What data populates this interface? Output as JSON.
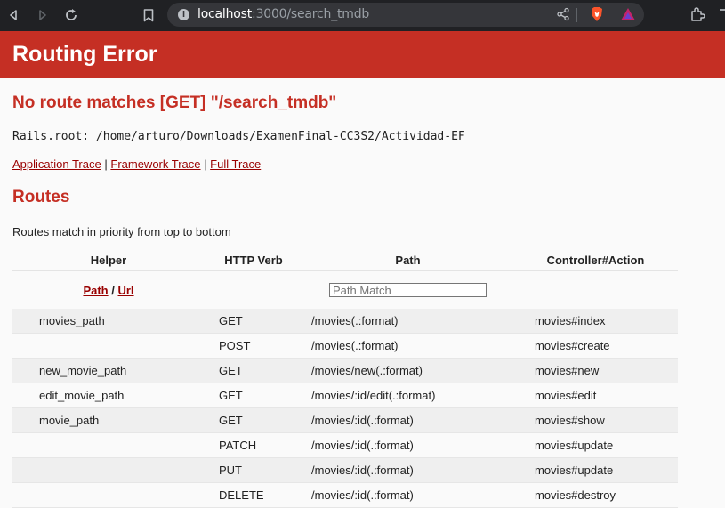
{
  "browser": {
    "url_host": "localhost",
    "url_rest": ":3000/search_tmdb",
    "icons": {
      "back": "back-arrow-icon",
      "forward": "forward-arrow-icon",
      "reload": "reload-icon",
      "bookmark": "bookmark-icon",
      "info": "site-info-icon",
      "share": "share-icon",
      "brave": "brave-shields-icon",
      "rewards": "brave-rewards-icon",
      "extensions": "extensions-icon"
    }
  },
  "page": {
    "header": "Routing Error",
    "message": "No route matches [GET] \"/search_tmdb\"",
    "rails_root_label": "Rails.root:",
    "rails_root": "/home/arturo/Downloads/ExamenFinal-CC3S2/Actividad-EF",
    "traces": {
      "application": "Application Trace",
      "framework": "Framework Trace",
      "full": "Full Trace",
      "separator": "|"
    },
    "routes_heading": "Routes",
    "routes_intro": "Routes match in priority from top to bottom"
  },
  "routes_table": {
    "headers": {
      "helper": "Helper",
      "verb": "HTTP Verb",
      "path": "Path",
      "action": "Controller#Action"
    },
    "filter": {
      "path_link": "Path",
      "separator": "/",
      "url_link": "Url",
      "search_placeholder": "Path Match"
    },
    "rows": [
      {
        "helper": "movies_path",
        "verb": "GET",
        "path": "/movies(.:format)",
        "action": "movies#index"
      },
      {
        "helper": "",
        "verb": "POST",
        "path": "/movies(.:format)",
        "action": "movies#create"
      },
      {
        "helper": "new_movie_path",
        "verb": "GET",
        "path": "/movies/new(.:format)",
        "action": "movies#new"
      },
      {
        "helper": "edit_movie_path",
        "verb": "GET",
        "path": "/movies/:id/edit(.:format)",
        "action": "movies#edit"
      },
      {
        "helper": "movie_path",
        "verb": "GET",
        "path": "/movies/:id(.:format)",
        "action": "movies#show"
      },
      {
        "helper": "",
        "verb": "PATCH",
        "path": "/movies/:id(.:format)",
        "action": "movies#update"
      },
      {
        "helper": "",
        "verb": "PUT",
        "path": "/movies/:id(.:format)",
        "action": "movies#update"
      },
      {
        "helper": "",
        "verb": "DELETE",
        "path": "/movies/:id(.:format)",
        "action": "movies#destroy"
      }
    ]
  },
  "colors": {
    "error_red": "#c52f24",
    "link_red": "#990000",
    "row_stripe": "#efefef",
    "chrome_bg": "#202124"
  }
}
